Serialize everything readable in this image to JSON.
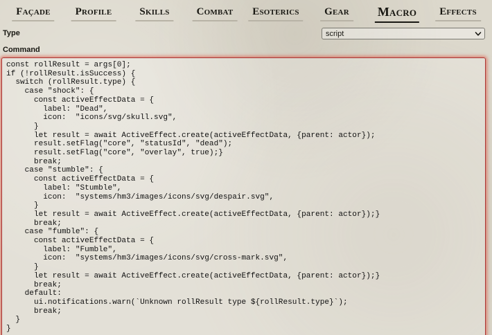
{
  "tabs": [
    {
      "label": "Façade",
      "active": false
    },
    {
      "label": "Profile",
      "active": false
    },
    {
      "label": "Skills",
      "active": false
    },
    {
      "label": "Combat",
      "active": false
    },
    {
      "label": "Esoterics",
      "active": false
    },
    {
      "label": "Gear",
      "active": false
    },
    {
      "label": "Macro",
      "active": true
    },
    {
      "label": "Effects",
      "active": false
    }
  ],
  "type_field": {
    "label": "Type",
    "value": "script"
  },
  "command_field": {
    "label": "Command",
    "code": "const rollResult = args[0];\nif (!rollResult.isSuccess) {\n  switch (rollResult.type) {\n    case \"shock\": {\n      const activeEffectData = {\n        label: \"Dead\",\n        icon:  \"icons/svg/skull.svg\",\n      }\n      let result = await ActiveEffect.create(activeEffectData, {parent: actor});\n      result.setFlag(\"core\", \"statusId\", \"dead\");\n      result.setFlag(\"core\", \"overlay\", true);}\n      break;\n    case \"stumble\": {\n      const activeEffectData = {\n        label: \"Stumble\",\n        icon:  \"systems/hm3/images/icons/svg/despair.svg\",\n      }\n      let result = await ActiveEffect.create(activeEffectData, {parent: actor});}\n      break;\n    case \"fumble\": {\n      const activeEffectData = {\n        label: \"Fumble\",\n        icon:  \"systems/hm3/images/icons/svg/cross-mark.svg\",\n      }\n      let result = await ActiveEffect.create(activeEffectData, {parent: actor});}\n      break;\n    default:\n      ui.notifications.warn(`Unknown rollResult type ${rollResult.type}`);\n      break;\n  }\n}"
  }
}
